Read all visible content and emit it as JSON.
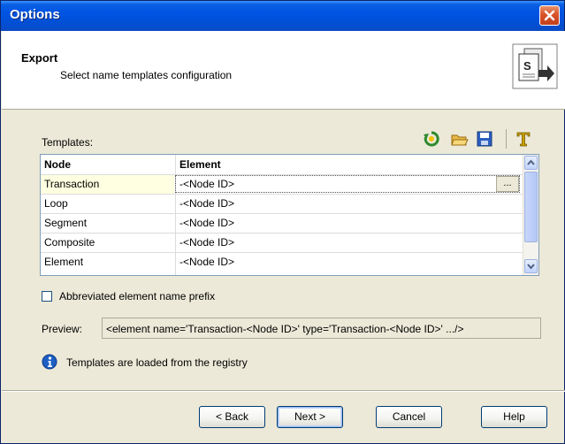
{
  "window": {
    "title": "Options"
  },
  "header": {
    "title": "Export",
    "subtitle": "Select name templates configuration"
  },
  "templates": {
    "label": "Templates:",
    "toolbar_icons": [
      "refresh-icon",
      "open-folder-icon",
      "save-icon",
      "font-icon"
    ],
    "columns": [
      "Node",
      "Element"
    ],
    "rows": [
      {
        "node": "Transaction",
        "element": "-<Node ID>"
      },
      {
        "node": "Loop",
        "element": "-<Node ID>"
      },
      {
        "node": "Segment",
        "element": "-<Node ID>"
      },
      {
        "node": "Composite",
        "element": "-<Node ID>"
      },
      {
        "node": "Element",
        "element": "-<Node ID>"
      }
    ],
    "ellipsis_label": "..."
  },
  "options": {
    "abbreviated_prefix_label": "Abbreviated element name prefix",
    "abbreviated_prefix_checked": false
  },
  "preview": {
    "label": "Preview:",
    "value": "<element name='Transaction-<Node ID>' type='Transaction-<Node ID>' .../>"
  },
  "info": {
    "text": "Templates are loaded from the registry"
  },
  "buttons": {
    "back": "< Back",
    "next": "Next >",
    "cancel": "Cancel",
    "help": "Help"
  },
  "colors": {
    "title_bar": "#0054e3",
    "dialog_bg": "#ece9d8",
    "grid_border": "#7f9db9",
    "selected_cell": "#ffffe1"
  }
}
